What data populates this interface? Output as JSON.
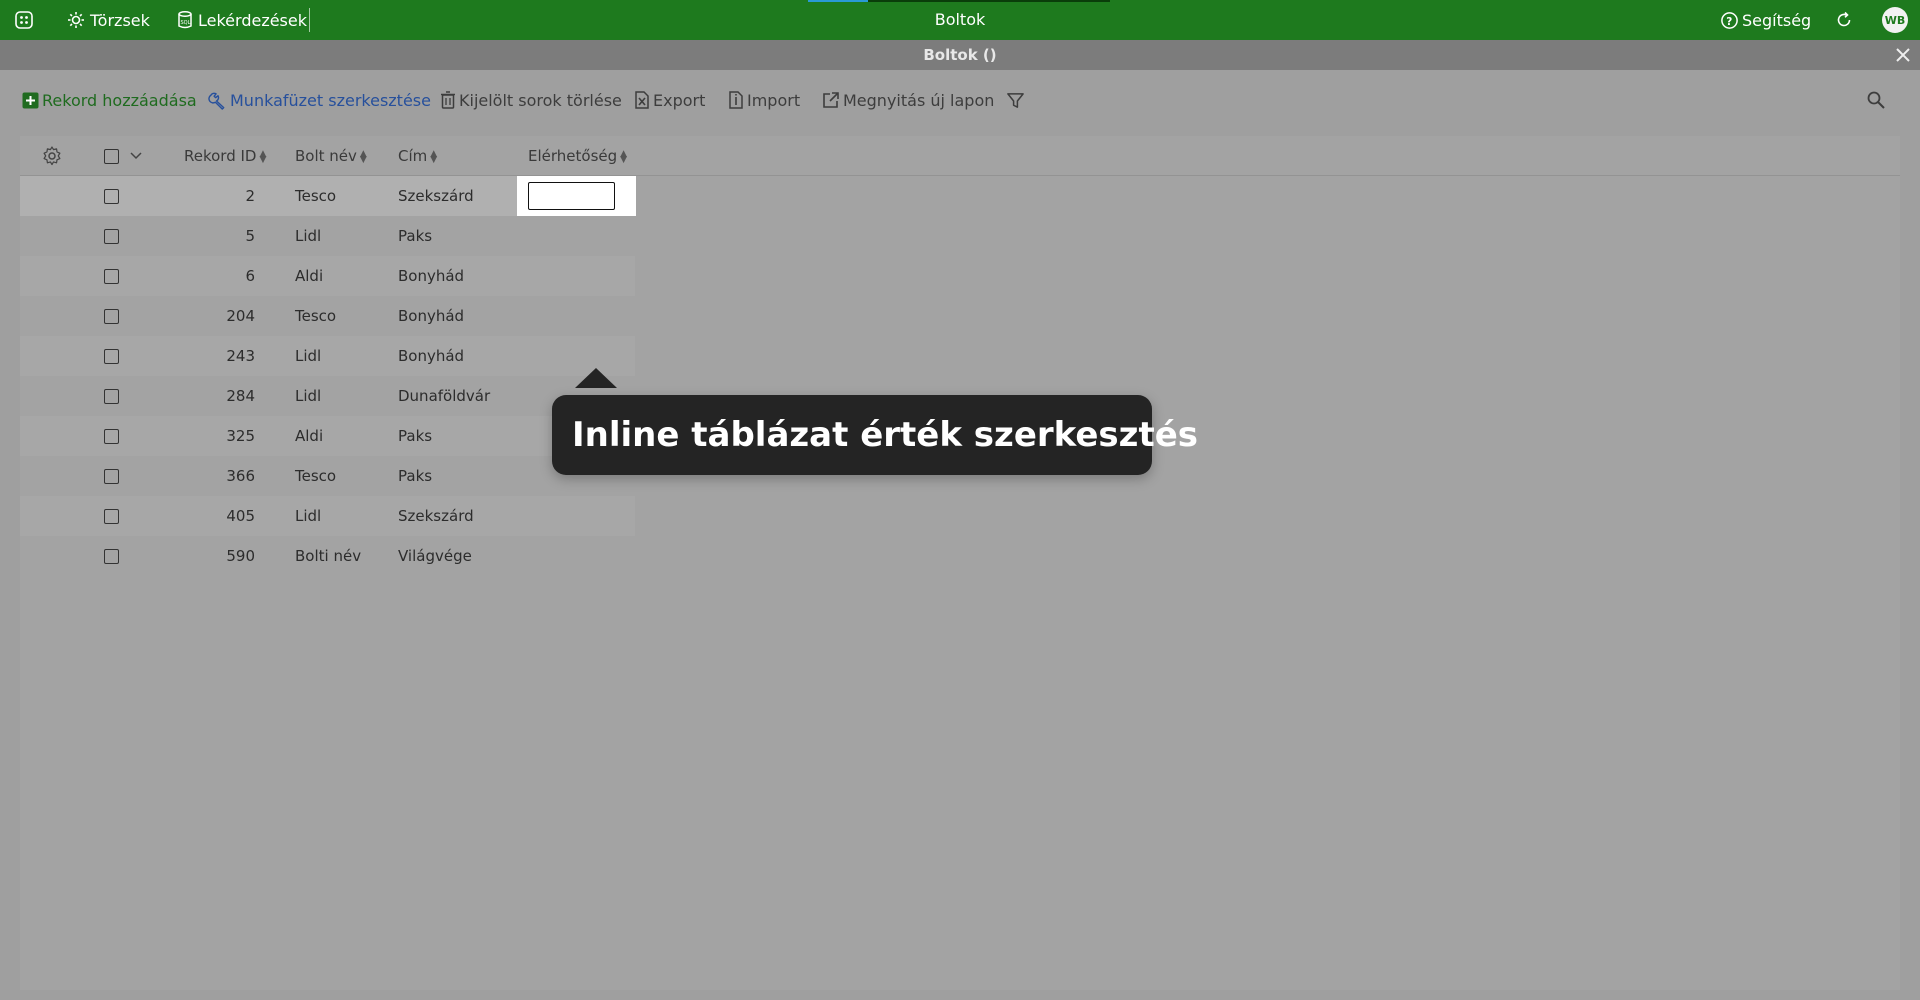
{
  "topbar": {
    "title": "Boltok",
    "torzsek_label": "Törzsek",
    "lekerdezesek_label": "Lekérdezések",
    "help_label": "Segítség",
    "avatar_initials": "WB",
    "progress_fraction": 0.2
  },
  "window": {
    "title": "Boltok ()"
  },
  "toolbar": {
    "add_record": "Rekord hozzáadása",
    "edit_workbook": "Munkafüzet szerkesztése",
    "delete_selected": "Kijelölt sorok törlése",
    "export": "Export",
    "import": "Import",
    "open_new_tab": "Megnyitás új lapon"
  },
  "table": {
    "columns": {
      "record_id": "Rekord ID",
      "shop_name": "Bolt név",
      "address": "Cím",
      "availability": "Elérhetőség"
    },
    "rows": [
      {
        "id": "2",
        "name": "Tesco",
        "address": "Szekszárd"
      },
      {
        "id": "5",
        "name": "Lidl",
        "address": "Paks"
      },
      {
        "id": "6",
        "name": "Aldi",
        "address": "Bonyhád"
      },
      {
        "id": "204",
        "name": "Tesco",
        "address": "Bonyhád"
      },
      {
        "id": "243",
        "name": "Lidl",
        "address": "Bonyhád"
      },
      {
        "id": "284",
        "name": "Lidl",
        "address": "Dunaföldvár"
      },
      {
        "id": "325",
        "name": "Aldi",
        "address": "Paks"
      },
      {
        "id": "366",
        "name": "Tesco",
        "address": "Paks"
      },
      {
        "id": "405",
        "name": "Lidl",
        "address": "Szekszárd"
      },
      {
        "id": "590",
        "name": "Bolti név",
        "address": "Világvége"
      }
    ],
    "edit_value": ""
  },
  "tooltip": {
    "text": "Inline táblázat érték szerkesztés"
  },
  "colors": {
    "topbar": "#1e7a1e",
    "window_bar": "#7c7c7c",
    "overlay": "#9f9f9f",
    "tooltip_bg": "#242424"
  }
}
